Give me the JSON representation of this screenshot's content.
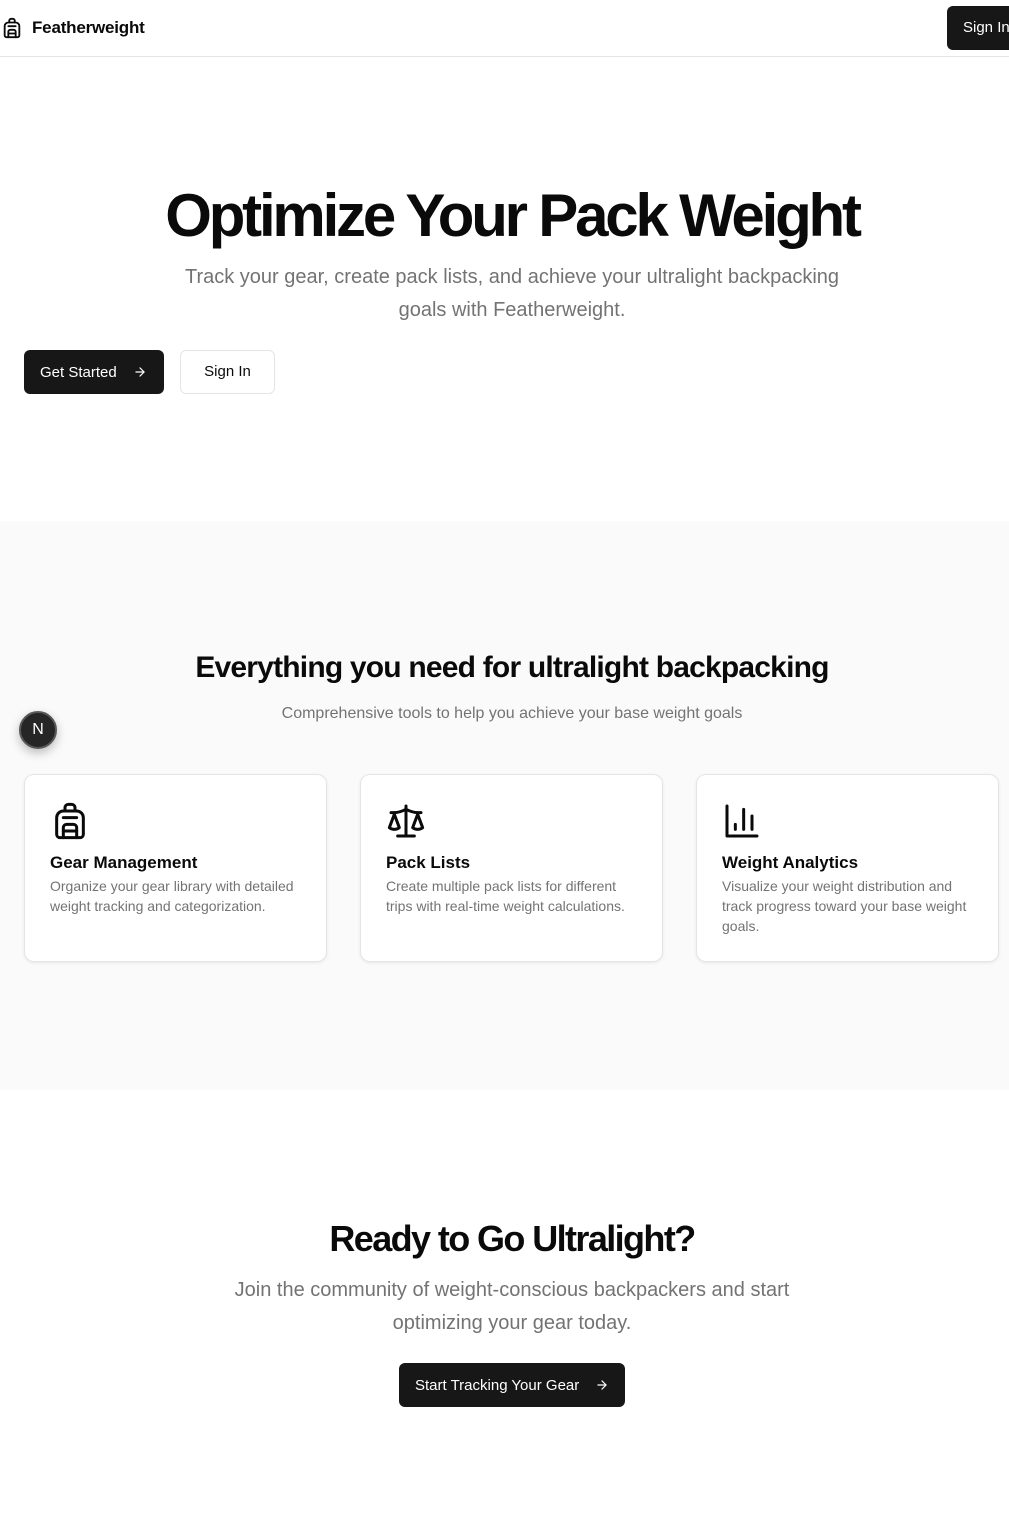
{
  "header": {
    "brand_icon": "backpack-icon",
    "brand_name": "Featherweight",
    "sign_in_label": "Sign In"
  },
  "hero": {
    "title": "Optimize Your Pack Weight",
    "subtitle": "Track your gear, create pack lists, and achieve your ultralight backpacking goals with Featherweight.",
    "get_started_label": "Get Started",
    "get_started_icon": "arrow-right-icon",
    "sign_in_label": "Sign In"
  },
  "features": {
    "title": "Everything you need for ultralight backpacking",
    "subtitle": "Comprehensive tools to help you achieve your base weight goals",
    "cards": [
      {
        "icon": "backpack-icon",
        "title": "Gear Management",
        "description": "Organize your gear library with detailed weight tracking and categorization."
      },
      {
        "icon": "scale-icon",
        "title": "Pack Lists",
        "description": "Create multiple pack lists for different trips with real-time weight calculations."
      },
      {
        "icon": "bar-chart-icon",
        "title": "Weight Analytics",
        "description": "Visualize your weight distribution and track progress toward your base weight goals."
      }
    ]
  },
  "badge": {
    "letter": "N"
  },
  "cta": {
    "title": "Ready to Go Ultralight?",
    "subtitle": "Join the community of weight-conscious backpackers and start optimizing your gear today.",
    "button_label": "Start Tracking Your Gear",
    "button_icon": "arrow-right-icon"
  },
  "colors": {
    "primary": "#171717",
    "muted_text": "#737373",
    "border": "#e5e5e5",
    "section_bg": "#fafafa"
  }
}
